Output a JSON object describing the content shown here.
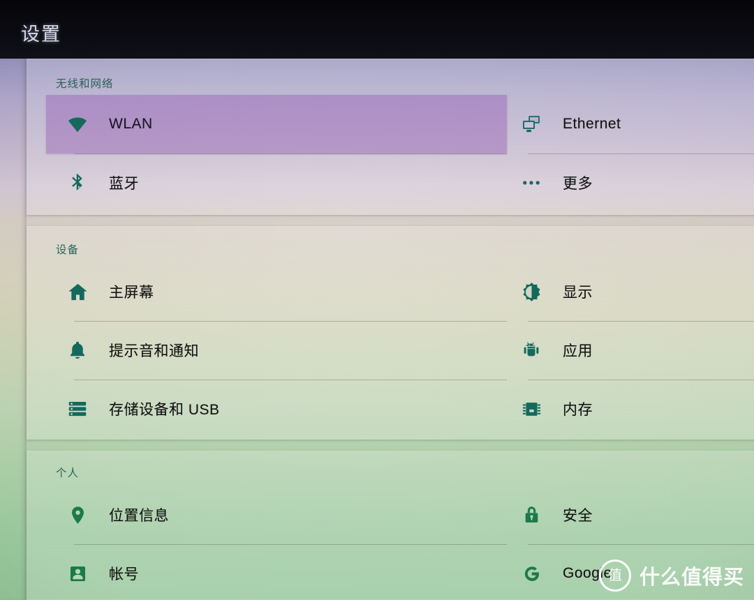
{
  "appbar": {
    "title": "设置"
  },
  "colors": {
    "icon_teal": "#14695c",
    "icon_green": "#1b7a4a",
    "selection": "#965fb4",
    "section_header": "#1d5a4c",
    "label": "#10100f",
    "appbar_bg": "#0b0b12",
    "appbar_title": "#d8d9e6"
  },
  "sections": [
    {
      "id": "wireless",
      "header": "无线和网络",
      "left_items": [
        {
          "label": "WLAN",
          "icon": "wifi-icon",
          "selected": true
        },
        {
          "label": "蓝牙",
          "icon": "bluetooth-icon",
          "selected": false
        }
      ],
      "right_items": [
        {
          "label": "Ethernet",
          "icon": "ethernet-icon",
          "selected": false
        },
        {
          "label": "更多",
          "icon": "more-icon",
          "selected": false
        }
      ]
    },
    {
      "id": "device",
      "header": "设备",
      "left_items": [
        {
          "label": "主屏幕",
          "icon": "home-icon",
          "selected": false
        },
        {
          "label": "提示音和通知",
          "icon": "bell-icon",
          "selected": false
        },
        {
          "label": "存储设备和 USB",
          "icon": "storage-icon",
          "selected": false
        }
      ],
      "right_items": [
        {
          "label": "显示",
          "icon": "brightness-icon",
          "selected": false
        },
        {
          "label": "应用",
          "icon": "android-icon",
          "selected": false
        },
        {
          "label": "内存",
          "icon": "memory-chip-icon",
          "selected": false
        }
      ]
    },
    {
      "id": "personal",
      "header": "个人",
      "left_items": [
        {
          "label": "位置信息",
          "icon": "location-pin-icon",
          "selected": false
        },
        {
          "label": "帐号",
          "icon": "person-icon",
          "selected": false
        }
      ],
      "right_items": [
        {
          "label": "安全",
          "icon": "lock-icon",
          "selected": false
        },
        {
          "label": "Google",
          "icon": "google-icon",
          "selected": false
        }
      ]
    }
  ],
  "watermark": {
    "badge": "值",
    "text": "什么值得买"
  }
}
